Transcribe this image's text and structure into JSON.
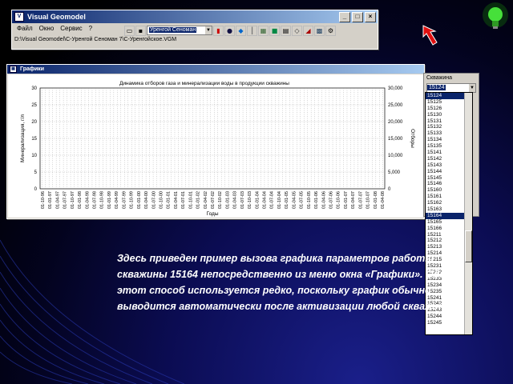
{
  "app": {
    "title": "Visual Geomodel",
    "menu": [
      "Файл",
      "Окно",
      "Сервис",
      "?"
    ],
    "combo_value": "Уренгой Сеноман",
    "path": "D:\\Visual Geomodel\\С-Уренгой Сеноман 7\\С-Уренгойское.VGM"
  },
  "graph_window": {
    "title": "Графики",
    "chart_title": "Динамика отборов газа и минерализации воды в продукции скважины",
    "side_label": "Скважина",
    "side_selected": "15124"
  },
  "wells": [
    "15124",
    "15125",
    "15126",
    "15130",
    "15131",
    "15132",
    "15133",
    "15134",
    "15135",
    "15141",
    "15142",
    "15143",
    "15144",
    "15145",
    "15146",
    "15160",
    "15161",
    "15162",
    "15163",
    "15164",
    "15165",
    "15166",
    "15211",
    "15212",
    "15213",
    "15214",
    "15215",
    "15231",
    "15232",
    "15233",
    "15234",
    "15235",
    "15241",
    "15242",
    "15243",
    "15244",
    "15245"
  ],
  "selected_well": "15164",
  "chart_data": {
    "type": "line",
    "title": "Динамика отборов газа и минерализации воды в продукции скважины",
    "xlabel": "Годы",
    "ylabel": "Минерализация, г/л",
    "y2label": "Отборы",
    "ylim": [
      0,
      30
    ],
    "y2lim": [
      0,
      30000
    ],
    "yticks": [
      "0",
      "5",
      "10",
      "15",
      "20",
      "25",
      "30"
    ],
    "y2ticks": [
      "0",
      "5,000",
      "10,000",
      "15,000",
      "20,000",
      "25,000",
      "30,000"
    ],
    "categories": [
      "01-10-96",
      "01-01-97",
      "01-04-97",
      "01-07-97",
      "01-10-97",
      "01-01-98",
      "01-04-98",
      "01-07-98",
      "01-10-98",
      "01-01-99",
      "01-04-99",
      "01-07-99",
      "01-10-99",
      "01-01-00",
      "01-04-00",
      "01-07-00",
      "01-10-00",
      "01-01-01",
      "01-04-01",
      "01-07-01",
      "01-10-01",
      "01-01-02",
      "01-04-02",
      "01-07-02",
      "01-10-02",
      "01-01-03",
      "01-04-03",
      "01-07-03",
      "01-10-03",
      "01-01-04",
      "01-04-04",
      "01-07-04",
      "01-10-04",
      "01-01-05",
      "01-04-05",
      "01-07-05",
      "01-10-05",
      "01-01-06",
      "01-04-06",
      "01-07-06",
      "01-10-06",
      "01-01-07",
      "01-04-07",
      "01-07-07",
      "01-10-07",
      "01-01-08",
      "01-04-08"
    ],
    "series": [],
    "grid": true
  },
  "caption": "Здесь приведен пример вызова графика параметров работы скважины 15164 непосредственно из меню окна «Графики». Однако этот способ используется редко, поскольку график обычно выводится автоматически после активизации любой скважины",
  "icons": [
    "app-icon",
    "minimize-icon",
    "maximize-icon",
    "close-icon",
    "red-arrow-icon",
    "lightbulb-icon"
  ],
  "colors": {
    "titlebar": "#0a246a",
    "bulb": "#39d12f",
    "arrow": "#e01010",
    "selection": "#0a246a"
  }
}
